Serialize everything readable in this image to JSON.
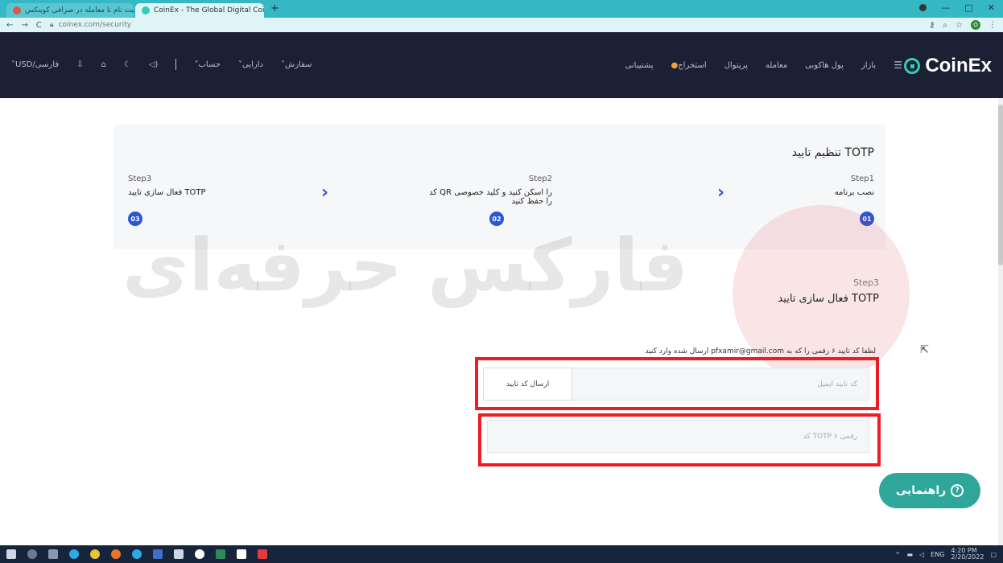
{
  "browser": {
    "tabs": [
      {
        "label": "از ثبت نام تا معامله در صرافی کوینکس...",
        "active": false
      },
      {
        "label": "CoinEx - The Global Digital Coin...",
        "active": true
      }
    ],
    "url": "coinex.com/security"
  },
  "nav": {
    "logo": "CoinEx",
    "menu": [
      "بازار",
      "پول هاکوبی",
      "معامله",
      "پرپتوال",
      "استخراج",
      "پشتیبانی"
    ],
    "right_menu": [
      "سفارش",
      "دارایی",
      "حساب"
    ],
    "currency": "USD/فارسی"
  },
  "page": {
    "title": "تنظیم تایید TOTP",
    "steps": [
      {
        "label": "Step1",
        "desc": "نصب برنامه",
        "num": "01"
      },
      {
        "label": "Step2",
        "desc": "کد QR را اسکن کنید و کلید خصوصی را حفظ کنید",
        "num": "02"
      },
      {
        "label": "Step3",
        "desc": "فعال سازی تایید TOTP",
        "num": "03"
      }
    ],
    "sub_step_label": "Step3",
    "sub_step_title": "فعال سازی تایید TOTP",
    "hint": "لطفا کد تایید ۶ رقمی را که به pfxamir@gmail.com ارسال شده وارد کنید",
    "email_code_placeholder": "کد تایید ایمیل",
    "send_code_label": "ارسال کد تایید",
    "totp_placeholder": "کد TOTP ۶ رقمی"
  },
  "watermark": "فارکس حرفه‌ای",
  "help_button": "راهنمایی",
  "taskbar": {
    "clock": "4:20 PM",
    "date": "2/20/2022"
  }
}
